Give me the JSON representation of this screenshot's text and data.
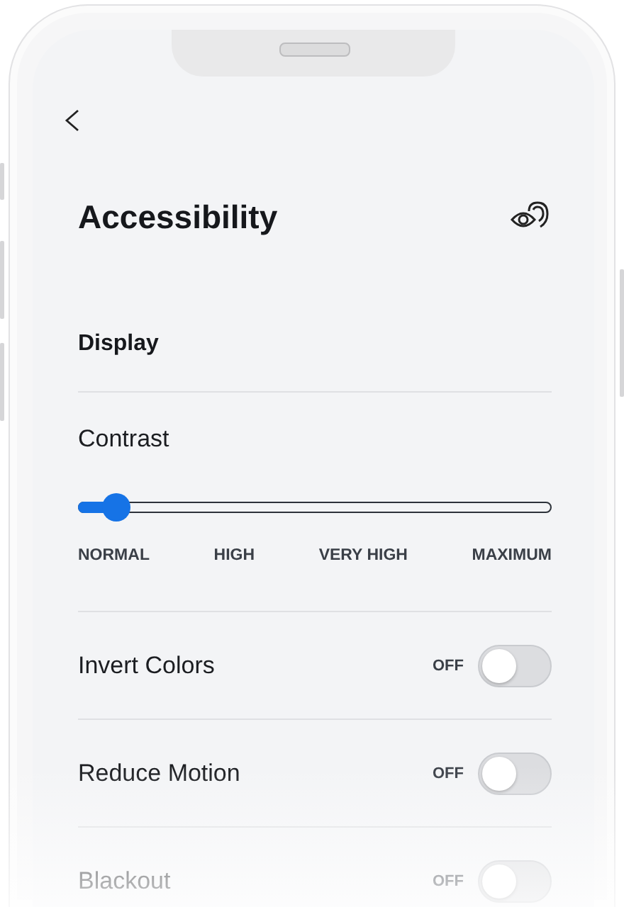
{
  "title": "Accessibility",
  "section": "Display",
  "contrast": {
    "label": "Contrast",
    "level": 0.08,
    "steps": [
      "NORMAL",
      "HIGH",
      "VERY HIGH",
      "MAXIMUM"
    ]
  },
  "settings": [
    {
      "label": "Invert Colors",
      "state_text": "OFF",
      "on": false
    },
    {
      "label": "Reduce Motion",
      "state_text": "OFF",
      "on": false
    },
    {
      "label": "Blackout",
      "state_text": "OFF",
      "on": false
    }
  ]
}
